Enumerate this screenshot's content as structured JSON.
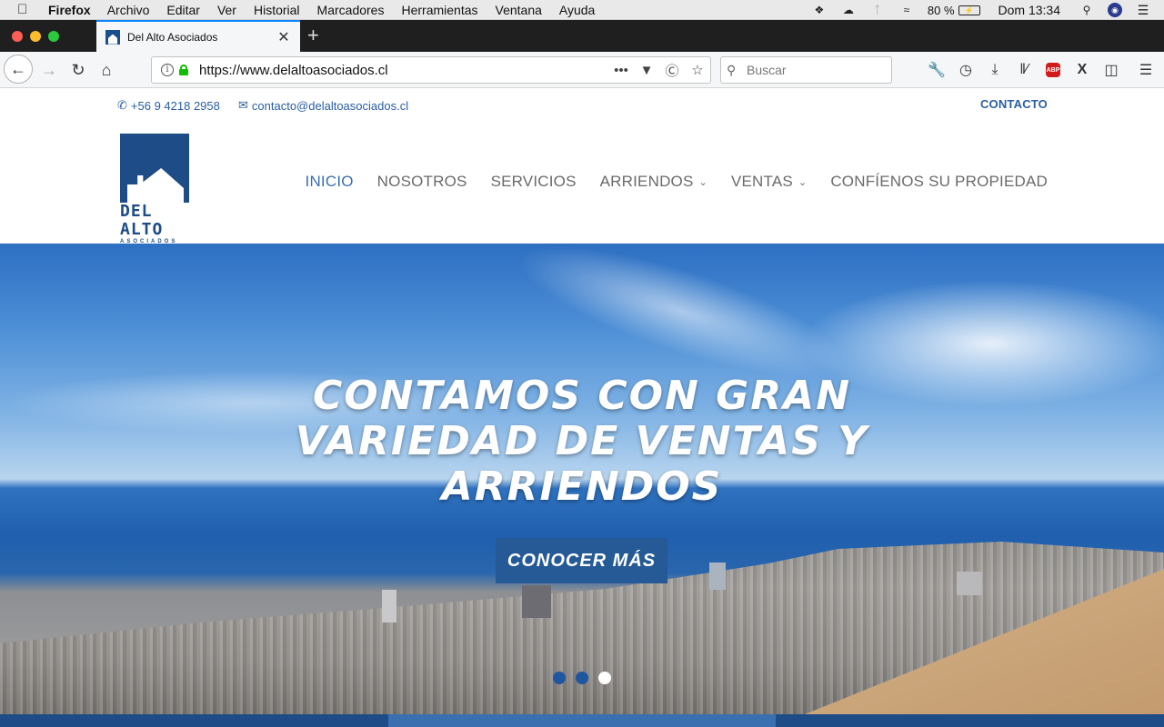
{
  "menubar": {
    "app": "Firefox",
    "items": [
      "Archivo",
      "Editar",
      "Ver",
      "Historial",
      "Marcadores",
      "Herramientas",
      "Ventana",
      "Ayuda"
    ],
    "battery": "80 %",
    "clock": "Dom 13:34"
  },
  "browser": {
    "tab_title": "Del Alto Asociados",
    "url": "https://www.delaltoasociados.cl",
    "search_placeholder": "Buscar",
    "overflow_label": "•••",
    "abp_label": "ABP"
  },
  "site": {
    "phone": "+56 9 4218 2958",
    "email": "contacto@delaltoasociados.cl",
    "contact_link": "CONTACTO",
    "logo": {
      "name": "DEL ALTO",
      "sub": "ASOCIADOS"
    },
    "nav": [
      {
        "label": "INICIO"
      },
      {
        "label": "NOSOTROS"
      },
      {
        "label": "SERVICIOS"
      },
      {
        "label": "ARRIENDOS"
      },
      {
        "label": "VENTAS"
      },
      {
        "label": "CONFÍENOS SU PROPIEDAD"
      }
    ],
    "hero": {
      "headline_line1": "CONTAMOS CON GRAN",
      "headline_line2": "VARIEDAD DE VENTAS Y",
      "headline_line3": "ARRIENDOS",
      "cta": "CONOCER MÁS",
      "active_slide": 3,
      "slide_count": 3
    }
  },
  "colors": {
    "brand_blue": "#1e4c86",
    "link_blue": "#2a5ea1",
    "cta_blue": "#255a96",
    "nav_active": "#3a6fb0",
    "traffic_red": "#fd5f57",
    "traffic_yellow": "#fdbb2e",
    "traffic_green": "#2bc840"
  },
  "icons": {
    "apple": "apple-icon",
    "phone": "phone-icon",
    "email": "envelope-icon"
  }
}
